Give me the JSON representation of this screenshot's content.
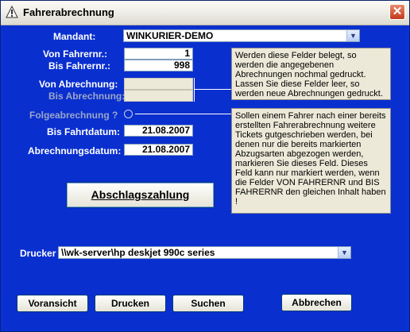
{
  "window": {
    "title": "Fahrerabrechnung",
    "close": "✕"
  },
  "mandant": {
    "label": "Mandant:",
    "value": "WINKURIER-DEMO"
  },
  "fahrer": {
    "von_label": "Von Fahrernr.:",
    "von_value": "1",
    "bis_label": "Bis Fahrernr.:",
    "bis_value": "998"
  },
  "abrechnung": {
    "von_label": "Von Abrechnung:",
    "von_value": "",
    "bis_label": "Bis Abrechnung:",
    "bis_value": ""
  },
  "note1": "Werden diese Felder belegt, so werden die angegebenen Abrechnungen nochmal gedruckt. Lassen Sie diese Felder leer, so werden neue Abrechnungen gedruckt.",
  "folge": {
    "label": "Folgeabrechnung ?"
  },
  "note2": "Sollen einem Fahrer nach einer bereits erstellten Fahrerabrechnung weitere Tickets gutgeschrieben werden, bei denen nur die bereits markierten Abzugsarten abgezogen werden, markieren Sie dieses Feld. Dieses Feld kann nur markiert werden, wenn die Felder VON FAHRERNR und BIS FAHRERNR den gleichen Inhalt haben !",
  "dates": {
    "fahrt_label": "Bis Fahrtdatum:",
    "fahrt_value": "21.08.2007",
    "abr_label": "Abrechnungsdatum:",
    "abr_value": "21.08.2007"
  },
  "abschlag": {
    "label": "Abschlagszahlung"
  },
  "drucker": {
    "label": "Drucker",
    "value": "\\\\wk-server\\hp deskjet 990c series"
  },
  "buttons": {
    "vorschau": "Voransicht",
    "drucken": "Drucken",
    "suchen": "Suchen",
    "abbrechen": "Abbrechen"
  },
  "colors": {
    "client_bg": "#0a2fcf",
    "title_bg": "#f0efe8",
    "close_bg": "#c2391b"
  }
}
